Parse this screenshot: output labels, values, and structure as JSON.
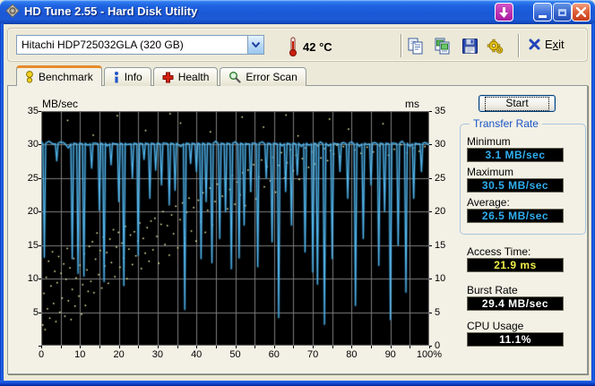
{
  "window": {
    "title": "HD Tune 2.55 - Hard Disk Utility"
  },
  "icons": {
    "app": "hard-disk",
    "download": "down-arrow",
    "minimize": "minimize-bar",
    "maximize": "maximize-box",
    "close": "close-x",
    "combo_arrow": "chevron-down",
    "temperature": "thermometer",
    "copy": "copy-pages",
    "copy_image": "copy-image",
    "save": "floppy-disk",
    "options": "gears",
    "exit": "blue-x",
    "tab_benchmark": "lightbulb",
    "tab_info": "info-i",
    "tab_health": "red-cross",
    "tab_error_scan": "magnifier"
  },
  "colors": {
    "titlebar_blue": "#1A57D5",
    "window_border": "#0F4BD8",
    "client_bg": "#ECE9D8",
    "panel_bg": "#F3F1E5",
    "tab_accent_orange": "#E68B2C",
    "value_cyan": "#30AEF0",
    "value_yellow": "#F0F04A",
    "value_white": "#FFFFFF",
    "groupbox_title_blue": "#1A55C8"
  },
  "toolbar": {
    "drive": "Hitachi HDP725032GLA (320 GB)",
    "temperature": "42 °C",
    "exit": {
      "pre": "E",
      "accel": "x",
      "post": "it"
    }
  },
  "tabs": [
    {
      "label": "Benchmark",
      "active": true
    },
    {
      "label": "Info",
      "active": false
    },
    {
      "label": "Health",
      "active": false
    },
    {
      "label": "Error Scan",
      "active": false
    }
  ],
  "right_panel": {
    "start_label": "Start",
    "transfer": {
      "title": "Transfer Rate",
      "min_label": "Minimum",
      "min_value": "3.1 MB/sec",
      "max_label": "Maximum",
      "max_value": "30.5 MB/sec",
      "avg_label": "Average:",
      "avg_value": "26.5 MB/sec"
    },
    "access": {
      "label": "Access Time:",
      "value": "21.9 ms"
    },
    "burst": {
      "label": "Burst Rate",
      "value": "29.4 MB/sec"
    },
    "cpu": {
      "label": "CPU Usage",
      "value": "11.1%"
    }
  },
  "chart_data": {
    "type": "line",
    "title": "HD Tune benchmark transfer rate with access-time scatter",
    "ylabel_left": "MB/sec",
    "ylabel_right": "ms",
    "ylim": [
      0,
      35
    ],
    "xlim": [
      0,
      100
    ],
    "y_ticks_left": [
      35,
      30,
      25,
      20,
      15,
      10,
      5
    ],
    "y_ticks_right": [
      35,
      30,
      25,
      20,
      15,
      10,
      5,
      0
    ],
    "x_tick_labels": [
      "0",
      "10",
      "20",
      "30",
      "40",
      "50",
      "60",
      "70",
      "80",
      "90",
      "100%"
    ],
    "grid": {
      "x_step_percent": 5,
      "y_step_units": 5
    },
    "colors": {
      "background": "#000000",
      "grid": "#7d7d7d",
      "line": "#54B8EE",
      "line_glow": "#2E7FB4",
      "scatter": "#FFFFB0"
    },
    "series": [
      {
        "name": "transfer-rate",
        "kind": "line",
        "baseline": [
          30.4,
          29.8,
          30.5,
          30.1,
          29.6,
          30.4,
          30.2,
          29.5,
          30.5,
          30.0,
          29.7,
          30.4,
          29.9,
          30.6,
          30.2,
          29.6,
          30.3,
          29.8,
          30.5,
          30.1,
          29.5,
          30.4,
          30.0,
          29.7,
          30.5,
          29.9,
          30.3,
          29.6,
          30.4,
          30.1,
          29.8,
          30.5,
          30.2,
          29.5,
          30.3,
          30.0,
          29.7,
          30.4,
          29.9,
          30.6,
          30.1,
          29.6,
          30.4,
          30.2,
          29.8,
          30.5,
          30.0,
          29.5,
          30.3,
          29.9,
          30.4,
          29.7,
          30.5,
          30.1,
          29.6,
          30.2,
          29.9,
          30.4,
          30.0,
          29.6,
          30.5,
          30.2,
          29.8,
          30.3,
          29.5,
          30.4,
          30.1,
          29.7,
          30.5,
          29.9,
          30.2,
          29.6,
          30.4,
          30.0,
          29.8,
          30.5,
          30.1,
          29.5,
          30.3,
          29.9,
          30.4,
          30.2,
          29.7,
          30.5,
          30.0,
          29.6,
          30.3,
          29.8,
          30.4,
          30.1,
          29.5,
          30.2,
          29.9,
          30.5,
          30.0,
          29.7,
          30.4,
          30.1,
          29.8,
          30.3,
          30.0
        ],
        "dips": [
          [
            0.8,
            13.2
          ],
          [
            4,
            27.6
          ],
          [
            8,
            13.0
          ],
          [
            9.5,
            10.8
          ],
          [
            11,
            10.4
          ],
          [
            13,
            26.5
          ],
          [
            15,
            20.2
          ],
          [
            16.2,
            9.6
          ],
          [
            18,
            27.0
          ],
          [
            20,
            21.5
          ],
          [
            21.3,
            9.0
          ],
          [
            23.5,
            25.0
          ],
          [
            25,
            13.5
          ],
          [
            26.5,
            27.8
          ],
          [
            28,
            22.0
          ],
          [
            29.5,
            26.2
          ],
          [
            31,
            24.0
          ],
          [
            33,
            21.0
          ],
          [
            34.5,
            23.2
          ],
          [
            37,
            5.4
          ],
          [
            38.5,
            27.2
          ],
          [
            40,
            26.0
          ],
          [
            41.2,
            13.0
          ],
          [
            42.5,
            21.5
          ],
          [
            44,
            12.4
          ],
          [
            46,
            16.0
          ],
          [
            47.5,
            20.0
          ],
          [
            49,
            11.5
          ],
          [
            51,
            13.1
          ],
          [
            52.3,
            18.0
          ],
          [
            54,
            23.0
          ],
          [
            55.8,
            11.8
          ],
          [
            58,
            25.0
          ],
          [
            59.5,
            15.5
          ],
          [
            61.2,
            4.2
          ],
          [
            63,
            23.0
          ],
          [
            64.5,
            18.0
          ],
          [
            66,
            25.5
          ],
          [
            68,
            14.0
          ],
          [
            70,
            11.0
          ],
          [
            71.2,
            9.2
          ],
          [
            73,
            3.2
          ],
          [
            75,
            13.0
          ],
          [
            77,
            26.0
          ],
          [
            79,
            22.0
          ],
          [
            81,
            6.0
          ],
          [
            83,
            16.0
          ],
          [
            85,
            24.0
          ],
          [
            87,
            12.0
          ],
          [
            88.5,
            20.0
          ],
          [
            90,
            3.9
          ],
          [
            92,
            15.0
          ],
          [
            94,
            8.0
          ],
          [
            96,
            22.0
          ],
          [
            98,
            26.0
          ]
        ]
      },
      {
        "name": "access-time",
        "kind": "scatter",
        "points": [
          [
            0.4,
            3.1
          ],
          [
            0.7,
            7.8
          ],
          [
            1.0,
            2.4
          ],
          [
            1.3,
            10.2
          ],
          [
            1.6,
            5.5
          ],
          [
            1.9,
            12.6
          ],
          [
            2.2,
            4.1
          ],
          [
            2.5,
            8.9
          ],
          [
            2.9,
            14.0
          ],
          [
            3.2,
            6.3
          ],
          [
            3.5,
            11.1
          ],
          [
            3.8,
            3.6
          ],
          [
            4.1,
            9.4
          ],
          [
            4.5,
            13.3
          ],
          [
            4.8,
            5.0
          ],
          [
            5.1,
            10.8
          ],
          [
            5.4,
            7.1
          ],
          [
            5.8,
            12.2
          ],
          [
            6.1,
            4.4
          ],
          [
            6.4,
            9.9
          ],
          [
            6.7,
            14.5
          ],
          [
            7.0,
            6.7
          ],
          [
            7.4,
            11.6
          ],
          [
            7.7,
            3.9
          ],
          [
            8.0,
            8.4
          ],
          [
            8.4,
            13.0
          ],
          [
            8.7,
            5.9
          ],
          [
            9.0,
            10.1
          ],
          [
            9.4,
            15.0
          ],
          [
            9.7,
            7.4
          ],
          [
            10.0,
            12.0
          ],
          [
            10.4,
            4.7
          ],
          [
            10.7,
            9.1
          ],
          [
            11.1,
            13.7
          ],
          [
            11.4,
            6.0
          ],
          [
            11.8,
            11.3
          ],
          [
            12.1,
            8.1
          ],
          [
            12.4,
            14.8
          ],
          [
            12.8,
            9.6
          ],
          [
            13.2,
            15.5
          ],
          [
            13.6,
            7.9
          ],
          [
            14.0,
            12.9
          ],
          [
            14.4,
            16.8
          ],
          [
            14.8,
            10.6
          ],
          [
            15.2,
            14.2
          ],
          [
            15.6,
            8.6
          ],
          [
            16.0,
            16.2
          ],
          [
            16.4,
            11.9
          ],
          [
            16.9,
            13.9
          ],
          [
            17.3,
            9.3
          ],
          [
            17.7,
            15.9
          ],
          [
            18.1,
            12.4
          ],
          [
            18.6,
            17.3
          ],
          [
            19.0,
            10.3
          ],
          [
            19.4,
            14.7
          ],
          [
            19.9,
            16.9
          ],
          [
            20.3,
            11.7
          ],
          [
            20.8,
            15.3
          ],
          [
            21.2,
            13.1
          ],
          [
            21.7,
            17.8
          ],
          [
            22.1,
            10.0
          ],
          [
            22.6,
            14.4
          ],
          [
            23.0,
            16.5
          ],
          [
            23.5,
            12.1
          ],
          [
            24.0,
            17.0
          ],
          [
            24.4,
            13.4
          ],
          [
            24.9,
            15.6
          ],
          [
            25.4,
            18.3
          ],
          [
            25.8,
            11.5
          ],
          [
            26.3,
            16.0
          ],
          [
            26.8,
            13.8
          ],
          [
            27.3,
            17.6
          ],
          [
            27.8,
            12.6
          ],
          [
            28.3,
            18.6
          ],
          [
            28.8,
            14.3
          ],
          [
            29.3,
            19.0
          ],
          [
            29.8,
            16.3
          ],
          [
            30.3,
            12.3
          ],
          [
            30.9,
            18.1
          ],
          [
            31.4,
            20.0
          ],
          [
            31.9,
            15.1
          ],
          [
            32.5,
            17.9
          ],
          [
            33.0,
            13.5
          ],
          [
            33.6,
            19.5
          ],
          [
            34.1,
            16.7
          ],
          [
            34.7,
            20.8
          ],
          [
            35.2,
            14.6
          ],
          [
            35.8,
            18.8
          ],
          [
            36.4,
            21.3
          ],
          [
            36.9,
            16.1
          ],
          [
            37.5,
            19.9
          ],
          [
            38.1,
            22.0
          ],
          [
            38.7,
            17.1
          ],
          [
            39.3,
            20.6
          ],
          [
            39.9,
            15.6
          ],
          [
            40.5,
            21.7
          ],
          [
            41.1,
            18.5
          ],
          [
            41.7,
            22.8
          ],
          [
            42.3,
            16.9
          ],
          [
            42.9,
            20.2
          ],
          [
            43.5,
            23.5
          ],
          [
            44.1,
            18.0
          ],
          [
            44.8,
            21.5
          ],
          [
            45.4,
            24.1
          ],
          [
            46.0,
            19.3
          ],
          [
            46.7,
            22.3
          ],
          [
            47.3,
            24.9
          ],
          [
            48.0,
            20.4
          ],
          [
            48.6,
            23.3
          ],
          [
            49.3,
            25.4
          ],
          [
            49.9,
            21.1
          ],
          [
            50.6,
            24.4
          ],
          [
            51.3,
            22.5
          ],
          [
            51.9,
            25.8
          ],
          [
            52.6,
            20.9
          ],
          [
            53.3,
            26.2
          ],
          [
            54.0,
            23.1
          ],
          [
            54.7,
            27.0
          ],
          [
            55.4,
            21.9
          ],
          [
            56.1,
            25.2
          ],
          [
            56.8,
            27.7
          ],
          [
            57.5,
            23.7
          ],
          [
            58.2,
            26.7
          ],
          [
            59.0,
            24.6
          ],
          [
            59.7,
            28.1
          ],
          [
            60.4,
            22.9
          ],
          [
            61.2,
            26.9
          ],
          [
            61.9,
            28.8
          ],
          [
            62.7,
            25.0
          ],
          [
            63.4,
            27.3
          ],
          [
            64.2,
            29.2
          ],
          [
            65.0,
            26.1
          ],
          [
            65.7,
            28.4
          ],
          [
            66.5,
            24.8
          ],
          [
            67.3,
            27.9
          ],
          [
            68.1,
            29.5
          ],
          [
            68.9,
            26.6
          ],
          [
            69.7,
            28.9
          ],
          [
            70.5,
            27.1
          ],
          [
            71.3,
            29.8
          ],
          [
            72.1,
            28.0
          ],
          [
            73.0,
            29.4
          ],
          [
            73.8,
            27.6
          ],
          [
            74.6,
            29.1
          ],
          [
            75.4,
            28.6
          ],
          [
            76.2,
            29.9
          ],
          [
            77.0,
            28.2
          ],
          [
            77.9,
            29.7
          ],
          [
            6.8,
            33.6
          ],
          [
            13.4,
            31.4
          ],
          [
            19.6,
            34.3
          ],
          [
            26.9,
            32.1
          ],
          [
            33.2,
            34.6
          ],
          [
            35.9,
            33.2
          ],
          [
            43.6,
            31.9
          ],
          [
            51.8,
            34.1
          ],
          [
            57.3,
            32.6
          ],
          [
            63.1,
            34.4
          ],
          [
            66.2,
            31.3
          ],
          [
            74.3,
            33.8
          ],
          [
            79.2,
            32.3
          ],
          [
            88.1,
            33.1
          ],
          [
            80.8,
            29.2
          ],
          [
            82.4,
            28.7
          ],
          [
            84.0,
            29.6
          ],
          [
            85.6,
            28.9
          ],
          [
            87.2,
            29.8
          ],
          [
            89.5,
            28.4
          ],
          [
            91.0,
            29.3
          ],
          [
            92.7,
            30.0
          ],
          [
            94.3,
            28.8
          ],
          [
            95.8,
            29.5
          ],
          [
            97.4,
            29.0
          ],
          [
            98.9,
            29.7
          ]
        ]
      }
    ]
  }
}
